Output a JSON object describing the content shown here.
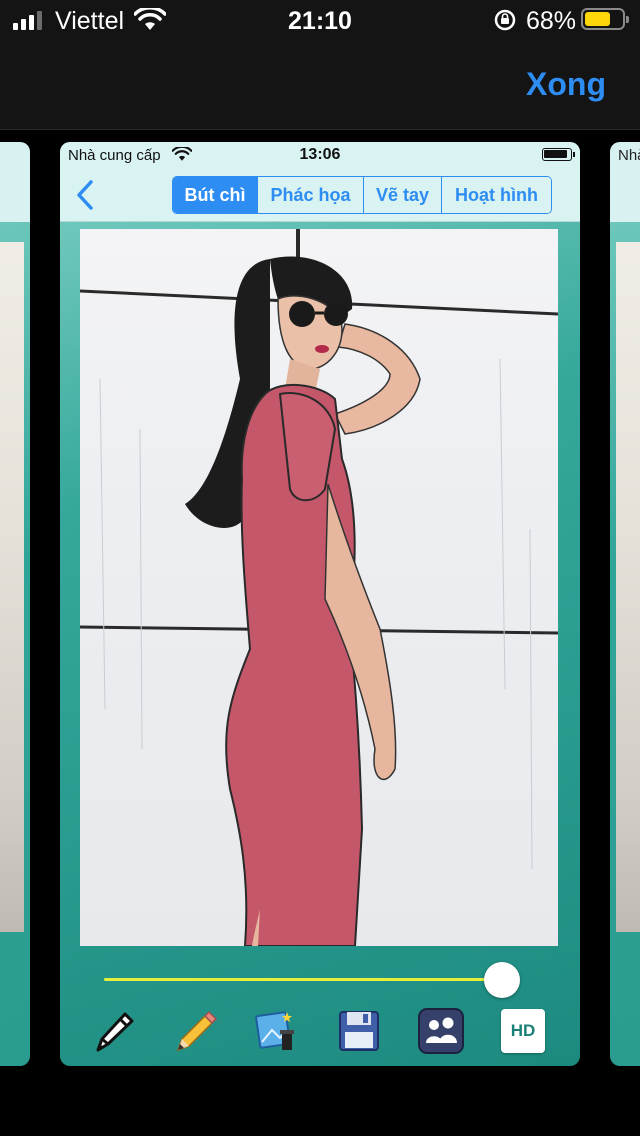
{
  "status_bar": {
    "carrier": "Viettel",
    "time": "21:10",
    "battery_percent": "68%",
    "battery_level": 0.68,
    "signal_bars": 3
  },
  "nav": {
    "done_label": "Xong"
  },
  "preview": {
    "status_carrier": "Nhà cung cấp",
    "status_time": "13:06",
    "side_right_carrier": "Nhà",
    "tabs": [
      {
        "label": "Bút chì",
        "active": true
      },
      {
        "label": "Phác họa",
        "active": false
      },
      {
        "label": "Vẽ tay",
        "active": false
      },
      {
        "label": "Hoạt hình",
        "active": false
      }
    ],
    "slider_value": 0.96,
    "toolbar": [
      {
        "icon": "pencil-outline-icon"
      },
      {
        "icon": "pencil-color-icon"
      },
      {
        "icon": "magic-photo-icon"
      },
      {
        "icon": "save-floppy-icon"
      },
      {
        "icon": "share-people-icon"
      },
      {
        "icon": "hd-icon",
        "label": "HD"
      }
    ]
  },
  "colors": {
    "accent": "#2e8df2",
    "slider": "#e6f03a",
    "card_top": "#d8f3f1",
    "teal": "#2b9e92"
  }
}
